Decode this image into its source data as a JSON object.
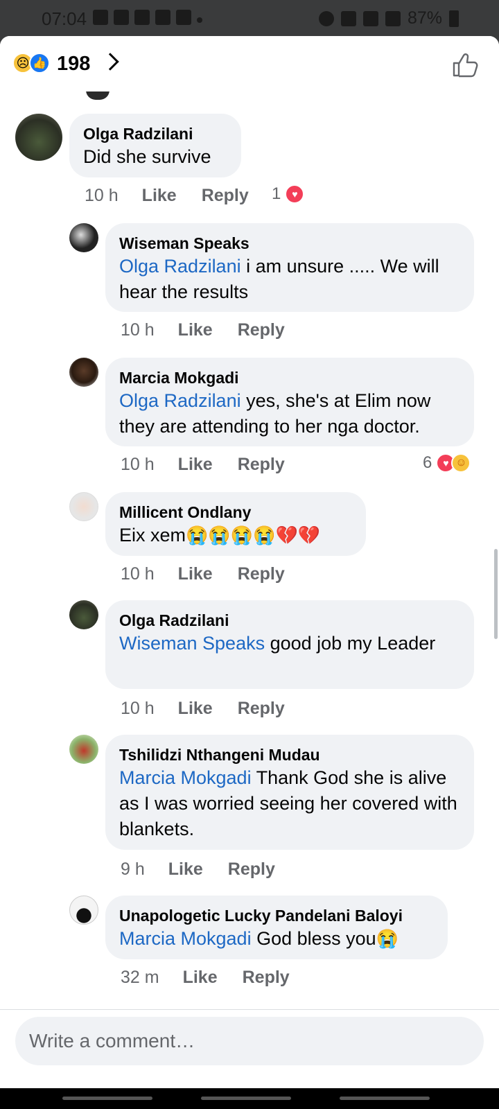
{
  "status": {
    "time": "07:04",
    "battery": "87%"
  },
  "header": {
    "reaction_count": "198",
    "icons": [
      "sad-reaction-icon",
      "like-reaction-icon"
    ]
  },
  "comments": [
    {
      "author": "Olga Radzilani",
      "mention": "",
      "text": "Did she survive",
      "time": "10 h",
      "like": "Like",
      "reply": "Reply",
      "reactions": "1"
    },
    {
      "author": "Wiseman Speaks",
      "mention": "Olga Radzilani",
      "text": " i am unsure ..... We will hear the results",
      "time": "10 h",
      "like": "Like",
      "reply": "Reply"
    },
    {
      "author": "Marcia Mokgadi",
      "mention": "Olga Radzilani",
      "text": " yes, she's at Elim now they are attending to her nga doctor.",
      "time": "10 h",
      "like": "Like",
      "reply": "Reply",
      "reactions": "6"
    },
    {
      "author": "Millicent Ondlany",
      "mention": "",
      "text": "Eix xem",
      "emoji": "😭😭😭😭💔💔",
      "time": "10 h",
      "like": "Like",
      "reply": "Reply"
    },
    {
      "author": "Olga Radzilani",
      "mention": "Wiseman Speaks",
      "text": " good job my Leader",
      "time": "10 h",
      "like": "Like",
      "reply": "Reply"
    },
    {
      "author": "Tshilidzi Nthangeni Mudau",
      "mention": "Marcia Mokgadi",
      "text": " Thank God she is alive as I was worried seeing her covered with blankets.",
      "time": "9 h",
      "like": "Like",
      "reply": "Reply"
    },
    {
      "author": "Unapologetic Lucky Pandelani Baloyi",
      "mention": "Marcia Mokgadi",
      "text": " God bless you",
      "emoji": "😭",
      "time": "32 m",
      "like": "Like",
      "reply": "Reply"
    }
  ],
  "composer": {
    "placeholder": "Write a comment…"
  },
  "colors": {
    "mention": "#1d68c4",
    "bubble": "#f0f2f5",
    "heart": "#f33e58",
    "like_blue": "#1877f2"
  }
}
